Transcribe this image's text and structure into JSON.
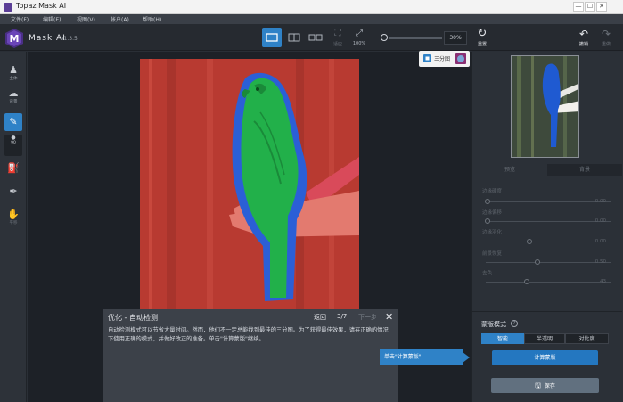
{
  "window": {
    "title": "Topaz Mask AI",
    "controls": [
      "—",
      "☐",
      "✕"
    ]
  },
  "menu": [
    "文件(F)",
    "编辑(E)",
    "视图(V)",
    "帐户(A)",
    "帮助(H)"
  ],
  "toolbar": {
    "brand": "Mask AI",
    "version": "v1.3.5",
    "fit_label": "适应",
    "zoom100_label": "100%",
    "zoom_value": "30%",
    "reset_label": "重置",
    "undo_label": "撤销",
    "redo_label": "重做"
  },
  "left_tools": {
    "subject_label": "主体",
    "background_label": "背景",
    "brush_size": "90",
    "hand_label": "平移"
  },
  "canvas": {
    "split_view_label": "三分图"
  },
  "right_panel": {
    "tabs": [
      "预览",
      "背景"
    ],
    "adjustments": [
      {
        "label": "边缘硬度",
        "value": "0.00"
      },
      {
        "label": "边缘偏移",
        "value": "0.00"
      },
      {
        "label": "边缘羽化",
        "value": "0.00"
      },
      {
        "label": "前景恢复",
        "value": "0.50"
      },
      {
        "label": "去色",
        "value": "43"
      }
    ],
    "mode_title": "蒙版模式",
    "modes": [
      "智能",
      "半透明",
      "对比度"
    ],
    "compute_button": "计算蒙版",
    "save_button": "保存"
  },
  "tutorial": {
    "title": "优化 - 自动检测",
    "back": "返回",
    "step": "3/7",
    "next": "下一步",
    "body": "自动检测模式可以节省大量时间。然而，他们不一定总能找到最佳的三分图。为了获得最佳效果，请在正确的情况下使用正确的模式，并做好改正的准备。单击\"计算蒙版\"继续。",
    "callout": "单击\"计算蒙版\""
  },
  "colors": {
    "accent": "#2f82c7",
    "cut_region": "#b83a31",
    "keep_region": "#22b04a",
    "compute_region": "#2b5fd6"
  }
}
